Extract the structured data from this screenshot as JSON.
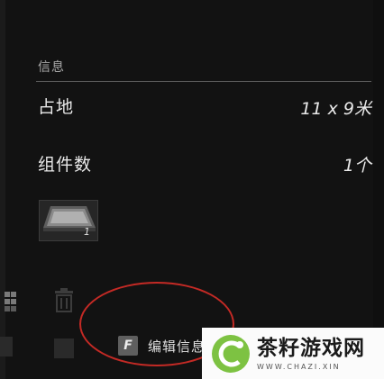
{
  "info": {
    "section_title": "信息",
    "rows": [
      {
        "label": "占地",
        "value": "11 x 9米"
      },
      {
        "label": "组件数",
        "value": "1个"
      }
    ]
  },
  "item_slot": {
    "count": "1"
  },
  "action": {
    "key": "F",
    "label": "编辑信息"
  },
  "watermark": {
    "title": "茶籽游戏网",
    "subtitle": "WWW.CHAZI.XIN"
  },
  "colors": {
    "background": "#121212",
    "highlight": "#c42a25",
    "watermark_green": "#7dc242"
  }
}
